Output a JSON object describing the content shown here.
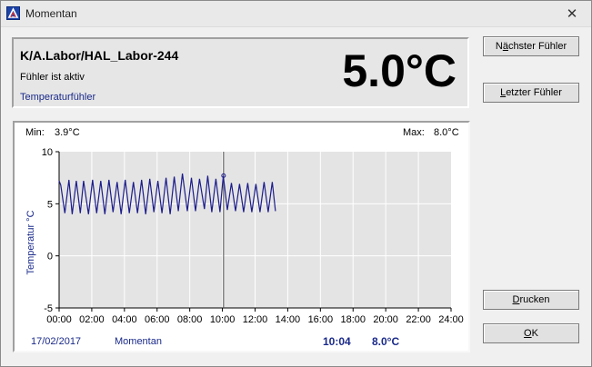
{
  "window": {
    "title": "Momentan",
    "close": "✕"
  },
  "sensor": {
    "name": "K/A.Labor/HAL_Labor-244",
    "status": "Fühler ist aktiv",
    "type": "Temperaturfühler",
    "current_temp": "5.0°C"
  },
  "buttons": {
    "next_prefix": "N",
    "next_hot": "ä",
    "next_rest": "chster Fühler",
    "last_prefix": "",
    "last_hot": "L",
    "last_rest": "etzter Fühler",
    "print_prefix": "",
    "print_hot": "D",
    "print_rest": "rucken",
    "ok_prefix": "",
    "ok_hot": "O",
    "ok_rest": "K"
  },
  "stats": {
    "min_label": "Min:",
    "min_value": "3.9°C",
    "max_label": "Max:",
    "max_value": "8.0°C"
  },
  "footer": {
    "date": "17/02/2017",
    "mode": "Momentan",
    "cursor_time": "10:04",
    "cursor_value": "8.0°C"
  },
  "colors": {
    "series": "#1c1c8c",
    "plot_bg": "#e4e4e4",
    "grid": "#ffffff",
    "info_text": "#1a2a8a"
  },
  "chart_data": {
    "type": "line",
    "ylabel": "Temperatur °C",
    "xlabel": "",
    "xlim": [
      0,
      24
    ],
    "ylim": [
      -5,
      10
    ],
    "y_ticks": [
      10,
      5,
      0,
      -5
    ],
    "x_tick_labels": [
      "00:00",
      "02:00",
      "04:00",
      "06:00",
      "08:00",
      "10:00",
      "12:00",
      "14:00",
      "16:00",
      "18:00",
      "20:00",
      "22:00",
      "24:00"
    ],
    "grid": true,
    "cursor_x": 10.07,
    "cursor_marker_y": 7.7,
    "series": [
      {
        "x": [
          0.0,
          0.1,
          0.35,
          0.6,
          0.8,
          1.05,
          1.3,
          1.5,
          1.8,
          2.05,
          2.3,
          2.55,
          2.8,
          3.05,
          3.3,
          3.55,
          3.8,
          4.05,
          4.3,
          4.55,
          4.8,
          5.05,
          5.3,
          5.55,
          5.8,
          6.05,
          6.3,
          6.55,
          6.8,
          7.05,
          7.3,
          7.55,
          7.85,
          8.1,
          8.35,
          8.6,
          8.9,
          9.1,
          9.35,
          9.6,
          9.85,
          10.05,
          10.3,
          10.55,
          10.8,
          11.05,
          11.3,
          11.55,
          11.8,
          12.05,
          12.3,
          12.55,
          12.8,
          13.05,
          13.25
        ],
        "y": [
          7.2,
          6.8,
          4.1,
          7.3,
          4.0,
          7.2,
          4.1,
          7.2,
          4.0,
          7.3,
          4.1,
          7.2,
          4.0,
          7.3,
          4.2,
          7.1,
          4.0,
          7.3,
          4.1,
          7.1,
          4.1,
          7.3,
          4.0,
          7.4,
          4.2,
          7.2,
          4.1,
          7.5,
          4.0,
          7.6,
          4.3,
          7.9,
          4.3,
          7.5,
          4.3,
          7.4,
          4.5,
          7.7,
          4.2,
          7.4,
          4.2,
          7.7,
          4.4,
          7.0,
          4.3,
          6.9,
          4.2,
          7.0,
          4.2,
          6.9,
          4.2,
          7.1,
          4.2,
          7.1,
          4.3
        ]
      }
    ]
  }
}
